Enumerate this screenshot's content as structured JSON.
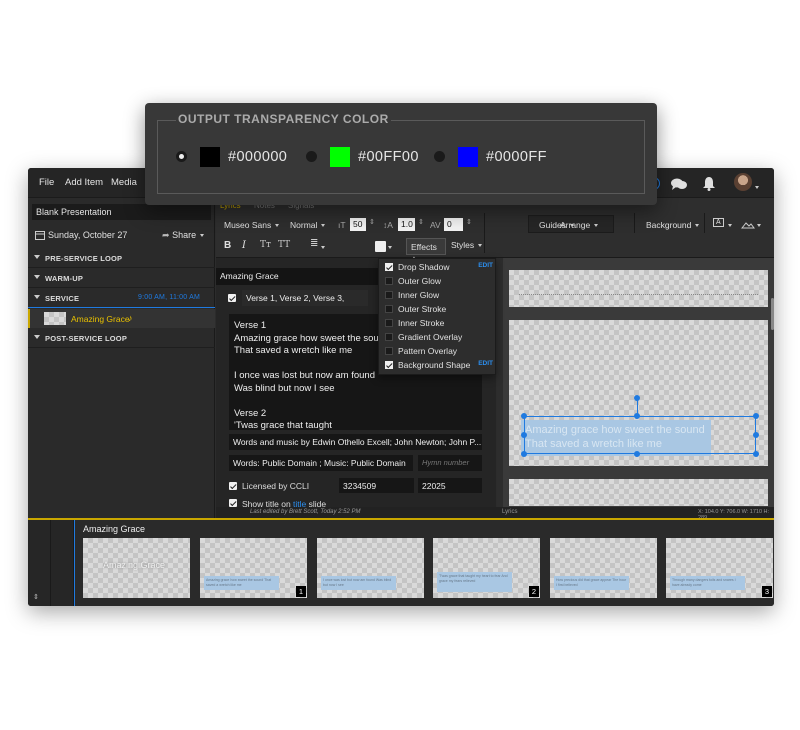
{
  "colors": {
    "accent": "#1f7ae0",
    "gold": "#c9a700",
    "background": "#2c2c2c"
  },
  "menubar": {
    "items": [
      "File",
      "Add Item",
      "Media"
    ],
    "icons": [
      "chat-icon",
      "bell-icon",
      "avatar"
    ]
  },
  "sidebar": {
    "presentation_name": "Blank Presentation",
    "date": "Sunday, October 27",
    "share_label": "Share",
    "sections": [
      {
        "label": "PRE-SERVICE LOOP"
      },
      {
        "label": "WARM-UP"
      },
      {
        "label": "SERVICE",
        "times": "9:00 AM, 11:00 AM"
      },
      {
        "label": "POST-SERVICE LOOP"
      }
    ],
    "active_item": "Amazing Grace",
    "active_item_icon": "music-note-icon"
  },
  "toolbar": {
    "tabs": [
      "Lyrics",
      "Notes",
      "Signals"
    ],
    "font_family": "Museo Sans",
    "font_weight": "Normal",
    "font_size": "50",
    "line_height": "1.0",
    "letter_spacing": "0",
    "guides": "Guides",
    "arrange": "Arrange",
    "background": "Background",
    "format_buttons": [
      "B",
      "I",
      "Tт",
      "TT"
    ],
    "effects": "Effects",
    "styles": "Styles"
  },
  "editor": {
    "song_title": "Amazing Grace",
    "arrangement": "Verse 1, Verse 2, Verse 3,",
    "lyrics": [
      "Verse 1",
      "Amazing grace how sweet the sound",
      "That saved a wretch like me",
      "",
      "I once was lost but now am found",
      "Was blind but now I see",
      "",
      "Verse 2",
      "'Twas grace that taught"
    ],
    "credits": "Words and music by Edwin Othello Excell; John Newton; John P...",
    "copyright": "Words: Public Domain ; Music: Public Domain",
    "hymn_placeholder": "Hymn number",
    "licensed_label": "Licensed by CCLI",
    "ccli_number": "3234509",
    "license_number": "22025",
    "show_title_prefix": "Show title on",
    "show_title_link": "title",
    "show_title_suffix": "slide",
    "last_edited": "Last edited by Brett Scott, Today 2:52 PM"
  },
  "effects_menu": {
    "items": [
      {
        "label": "Drop Shadow",
        "checked": true,
        "edit": "EDIT"
      },
      {
        "label": "Outer Glow",
        "checked": false
      },
      {
        "label": "Inner Glow",
        "checked": false
      },
      {
        "label": "Outer Stroke",
        "checked": false
      },
      {
        "label": "Inner Stroke",
        "checked": false
      },
      {
        "label": "Gradient Overlay",
        "checked": false
      },
      {
        "label": "Pattern Overlay",
        "checked": false
      },
      {
        "label": "Background Shape",
        "checked": true,
        "edit": "EDIT"
      }
    ]
  },
  "canvas": {
    "slide_text_line1": "Amazing grace how sweet the sound",
    "slide_text_line2": "That saved a wretch like me",
    "layer_label": "Lyrics",
    "coords": "X: 104.0  Y: 706.0  W: 1710  H: 289"
  },
  "strip": {
    "title": "Amazing Grace",
    "thumbs": [
      {
        "text": "Amazing Grace",
        "num": ""
      },
      {
        "text": "Amazing grace how sweet the sound That saved a wretch like me",
        "num": "1"
      },
      {
        "text": "I once was lost but now am found Was blind but now I see",
        "num": ""
      },
      {
        "text": "'Twas grace that taught my heart to fear And grace my fears relieved",
        "num": "2"
      },
      {
        "text": "How precious did that grace appear The hour I first believed",
        "num": ""
      },
      {
        "text": "Through many dangers toils and snares I have already come",
        "num": "3"
      }
    ]
  },
  "transparency": {
    "title": "OUTPUT TRANSPARENCY COLOR",
    "options": [
      {
        "hex": "#000000",
        "color": "#000000",
        "selected": true
      },
      {
        "hex": "#00FF00",
        "color": "#00ff00",
        "selected": false
      },
      {
        "hex": "#0000FF",
        "color": "#0000ff",
        "selected": false
      }
    ]
  }
}
